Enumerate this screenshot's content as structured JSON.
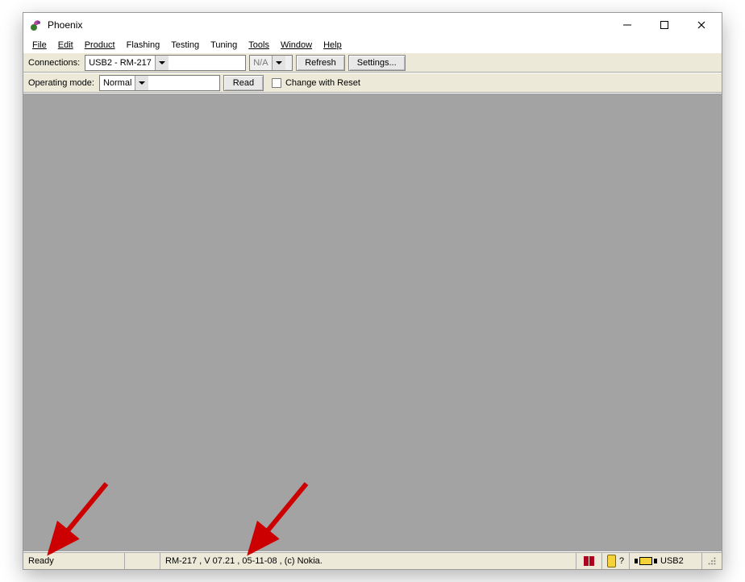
{
  "title": "Phoenix",
  "menu": {
    "file": "File",
    "edit": "Edit",
    "product": "Product",
    "flashing": "Flashing",
    "testing": "Testing",
    "tuning": "Tuning",
    "tools": "Tools",
    "window": "Window",
    "help": "Help"
  },
  "toolbar1": {
    "connections_label": "Connections:",
    "connection_value": "USB2 - RM-217",
    "na_value": "N/A",
    "refresh": "Refresh",
    "settings": "Settings..."
  },
  "toolbar2": {
    "mode_label": "Operating mode:",
    "mode_value": "Normal",
    "read": "Read",
    "change_with_reset": "Change with Reset"
  },
  "status": {
    "ready": "Ready",
    "device_info": "RM-217 , V 07.21 , 05-11-08 , (c) Nokia.",
    "help_mark": "?",
    "usb": "USB2"
  }
}
